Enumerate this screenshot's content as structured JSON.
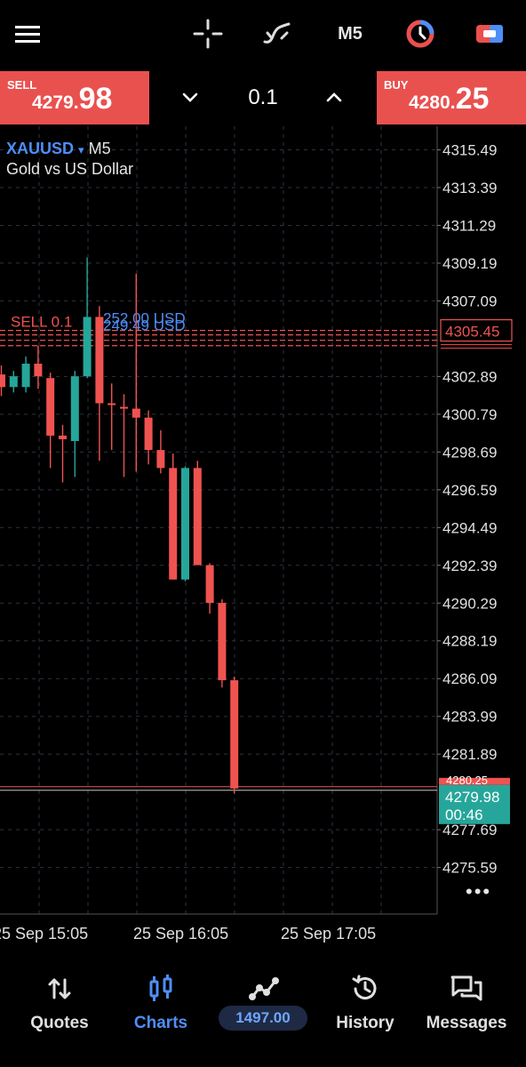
{
  "topbar": {
    "timeframe": "M5"
  },
  "trade": {
    "sell": {
      "label": "SELL",
      "price_prefix": "4279.",
      "price_big": "98"
    },
    "buy": {
      "label": "BUY",
      "price_prefix": "4280.",
      "price_big": "25"
    },
    "lot": "0.1"
  },
  "chart": {
    "symbol": "XAUUSD",
    "symbol_arrow": "▾",
    "timeframe": "M5",
    "description": "Gold vs US Dollar",
    "position_line_label": "SELL 0.1",
    "profit_label_1": "252.00 USD",
    "profit_label_2": "249.49 USD",
    "open_price_tag": "4305.45",
    "current_price_tag": "4279.98",
    "bar_countdown": "00:46",
    "current_top_partial": "4280.25",
    "more_menu": "•••",
    "price_axis": [
      "4315.49",
      "4313.39",
      "4311.29",
      "4309.19",
      "4307.09",
      "4302.89",
      "4300.79",
      "4298.69",
      "4296.59",
      "4294.49",
      "4292.39",
      "4290.29",
      "4288.19",
      "4286.09",
      "4283.99",
      "4281.89",
      "4277.69",
      "4275.59"
    ],
    "time_axis": [
      "25 Sep 15:05",
      "25 Sep 16:05",
      "25 Sep 17:05"
    ],
    "colors": {
      "bull": "#26a69a",
      "bear": "#ef5350",
      "grid": "#2c3344",
      "sell_line": "#ef5350",
      "bid_tag": "#26a69a"
    }
  },
  "chart_data": {
    "type": "candlestick",
    "symbol": "XAUUSD",
    "timeframe": "M5",
    "ylim": [
      4273.0,
      4316.8
    ],
    "candles": [
      {
        "o": 4303.0,
        "h": 4303.5,
        "l": 4301.8,
        "c": 4302.3
      },
      {
        "o": 4302.3,
        "h": 4303.2,
        "l": 4302.0,
        "c": 4302.9
      },
      {
        "o": 4302.3,
        "h": 4304.0,
        "l": 4302.0,
        "c": 4303.6
      },
      {
        "o": 4303.6,
        "h": 4304.6,
        "l": 4302.2,
        "c": 4302.9
      },
      {
        "o": 4302.8,
        "h": 4303.1,
        "l": 4297.8,
        "c": 4299.6
      },
      {
        "o": 4299.6,
        "h": 4300.2,
        "l": 4297.0,
        "c": 4299.4
      },
      {
        "o": 4299.3,
        "h": 4303.2,
        "l": 4297.3,
        "c": 4302.9
      },
      {
        "o": 4302.9,
        "h": 4309.5,
        "l": 4302.8,
        "c": 4306.2
      },
      {
        "o": 4306.2,
        "h": 4306.8,
        "l": 4298.2,
        "c": 4301.4
      },
      {
        "o": 4301.4,
        "h": 4302.5,
        "l": 4298.8,
        "c": 4301.3
      },
      {
        "o": 4301.2,
        "h": 4301.9,
        "l": 4297.3,
        "c": 4301.1
      },
      {
        "o": 4301.1,
        "h": 4308.6,
        "l": 4297.6,
        "c": 4300.6
      },
      {
        "o": 4300.6,
        "h": 4301.0,
        "l": 4298.0,
        "c": 4298.8
      },
      {
        "o": 4298.8,
        "h": 4299.9,
        "l": 4297.5,
        "c": 4297.8
      },
      {
        "o": 4297.8,
        "h": 4298.6,
        "l": 4291.6,
        "c": 4291.6
      },
      {
        "o": 4291.6,
        "h": 4297.9,
        "l": 4291.5,
        "c": 4297.8
      },
      {
        "o": 4297.8,
        "h": 4298.2,
        "l": 4292.7,
        "c": 4292.4
      },
      {
        "o": 4292.4,
        "h": 4292.5,
        "l": 4289.7,
        "c": 4290.3
      },
      {
        "o": 4290.3,
        "h": 4290.5,
        "l": 4285.6,
        "c": 4286.0
      },
      {
        "o": 4286.0,
        "h": 4286.2,
        "l": 4279.7,
        "c": 4279.98
      }
    ],
    "position_open": 4305.45,
    "position_stack": [
      4305.2,
      4304.9,
      4304.6
    ],
    "current_price": 4279.98
  },
  "bottomnav": {
    "items": [
      {
        "name": "quotes",
        "label": "Quotes"
      },
      {
        "name": "charts",
        "label": "Charts"
      },
      {
        "name": "trade",
        "label": ""
      },
      {
        "name": "history",
        "label": "History"
      },
      {
        "name": "messages",
        "label": "Messages"
      }
    ],
    "balance": "1497.00"
  }
}
